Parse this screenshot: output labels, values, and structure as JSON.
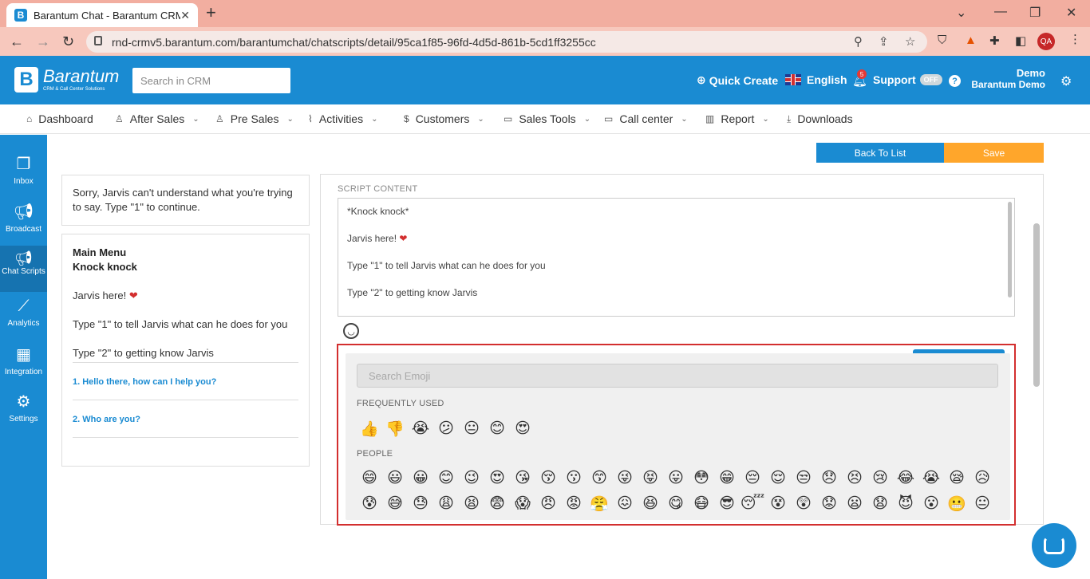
{
  "browser": {
    "tab_title": "Barantum Chat - Barantum CRM",
    "url": "rnd-crmv5.barantum.com/barantumchat/chatscripts/detail/95ca1f85-96fd-4d5d-861b-5cd1ff3255cc",
    "profile": "QA"
  },
  "header": {
    "brand": "Barantum",
    "brand_tagline": "CRM & Call Center Solutions",
    "search_placeholder": "Search in CRM",
    "quick_create": "Quick Create",
    "language": "English",
    "notif_count": "5",
    "support_label": "Support",
    "support_state": "OFF",
    "user_name": "Demo",
    "user_org": "Barantum Demo"
  },
  "menu": {
    "items": [
      {
        "label": "Dashboard",
        "icon": "home-icon"
      },
      {
        "label": "After Sales",
        "icon": "users-icon"
      },
      {
        "label": "Pre Sales",
        "icon": "users-icon"
      },
      {
        "label": "Activities",
        "icon": "pulse-icon"
      },
      {
        "label": "Customers",
        "icon": "dollar-icon"
      },
      {
        "label": "Sales Tools",
        "icon": "folder-icon"
      },
      {
        "label": "Call center",
        "icon": "folder-icon"
      },
      {
        "label": "Report",
        "icon": "chart-icon"
      },
      {
        "label": "Downloads",
        "icon": "download-icon"
      }
    ]
  },
  "sidebar": {
    "items": [
      {
        "label": "Inbox"
      },
      {
        "label": "Broadcast"
      },
      {
        "label": "Chat Scripts"
      },
      {
        "label": "Analytics"
      },
      {
        "label": "Integration"
      },
      {
        "label": "Settings"
      }
    ]
  },
  "actions": {
    "back": "Back To List",
    "save": "Save"
  },
  "preview": {
    "fallback": "Sorry, Jarvis can't understand what you're trying to say. Type \"1\" to continue.",
    "menu_title": "Main Menu",
    "menu_subtitle": "Knock knock",
    "line1": "Jarvis here!",
    "line2": "Type \"1\" to tell Jarvis what can he does for you",
    "line3": "Type \"2\" to getting know Jarvis",
    "options": [
      "1. Hello there, how can I help you?",
      "2. Who are you?"
    ]
  },
  "editor": {
    "section_label": "SCRIPT CONTENT",
    "lines": [
      "*Knock knock*",
      "Jarvis here!",
      "Type \"1\" to tell Jarvis what can he does for you",
      "Type \"2\" to getting know Jarvis"
    ]
  },
  "emoji_picker": {
    "search_placeholder": "Search Emoji",
    "frequent_label": "FREQUENTLY USED",
    "people_label": "PEOPLE",
    "frequent": [
      "👍",
      "👎",
      "😭",
      "😕",
      "😐",
      "😊",
      "😍"
    ],
    "people_row1": [
      "😄",
      "😃",
      "😀",
      "😊",
      "😉",
      "😍",
      "😘",
      "😚",
      "😗",
      "😙",
      "😜",
      "😝",
      "😛",
      "😳",
      "😁",
      "😔",
      "😌",
      "😒",
      "😞",
      "😣",
      "😢",
      "😂",
      "😭",
      "😪",
      "😥"
    ],
    "people_row2": [
      "😰",
      "😅",
      "😓",
      "😩",
      "😫",
      "😨",
      "😱",
      "😠",
      "😡",
      "😤",
      "😖",
      "😆",
      "😋",
      "😷",
      "😎",
      "😴",
      "😵",
      "😲",
      "😟",
      "😦",
      "😧",
      "😈",
      "😮",
      "😬",
      "😐"
    ]
  }
}
